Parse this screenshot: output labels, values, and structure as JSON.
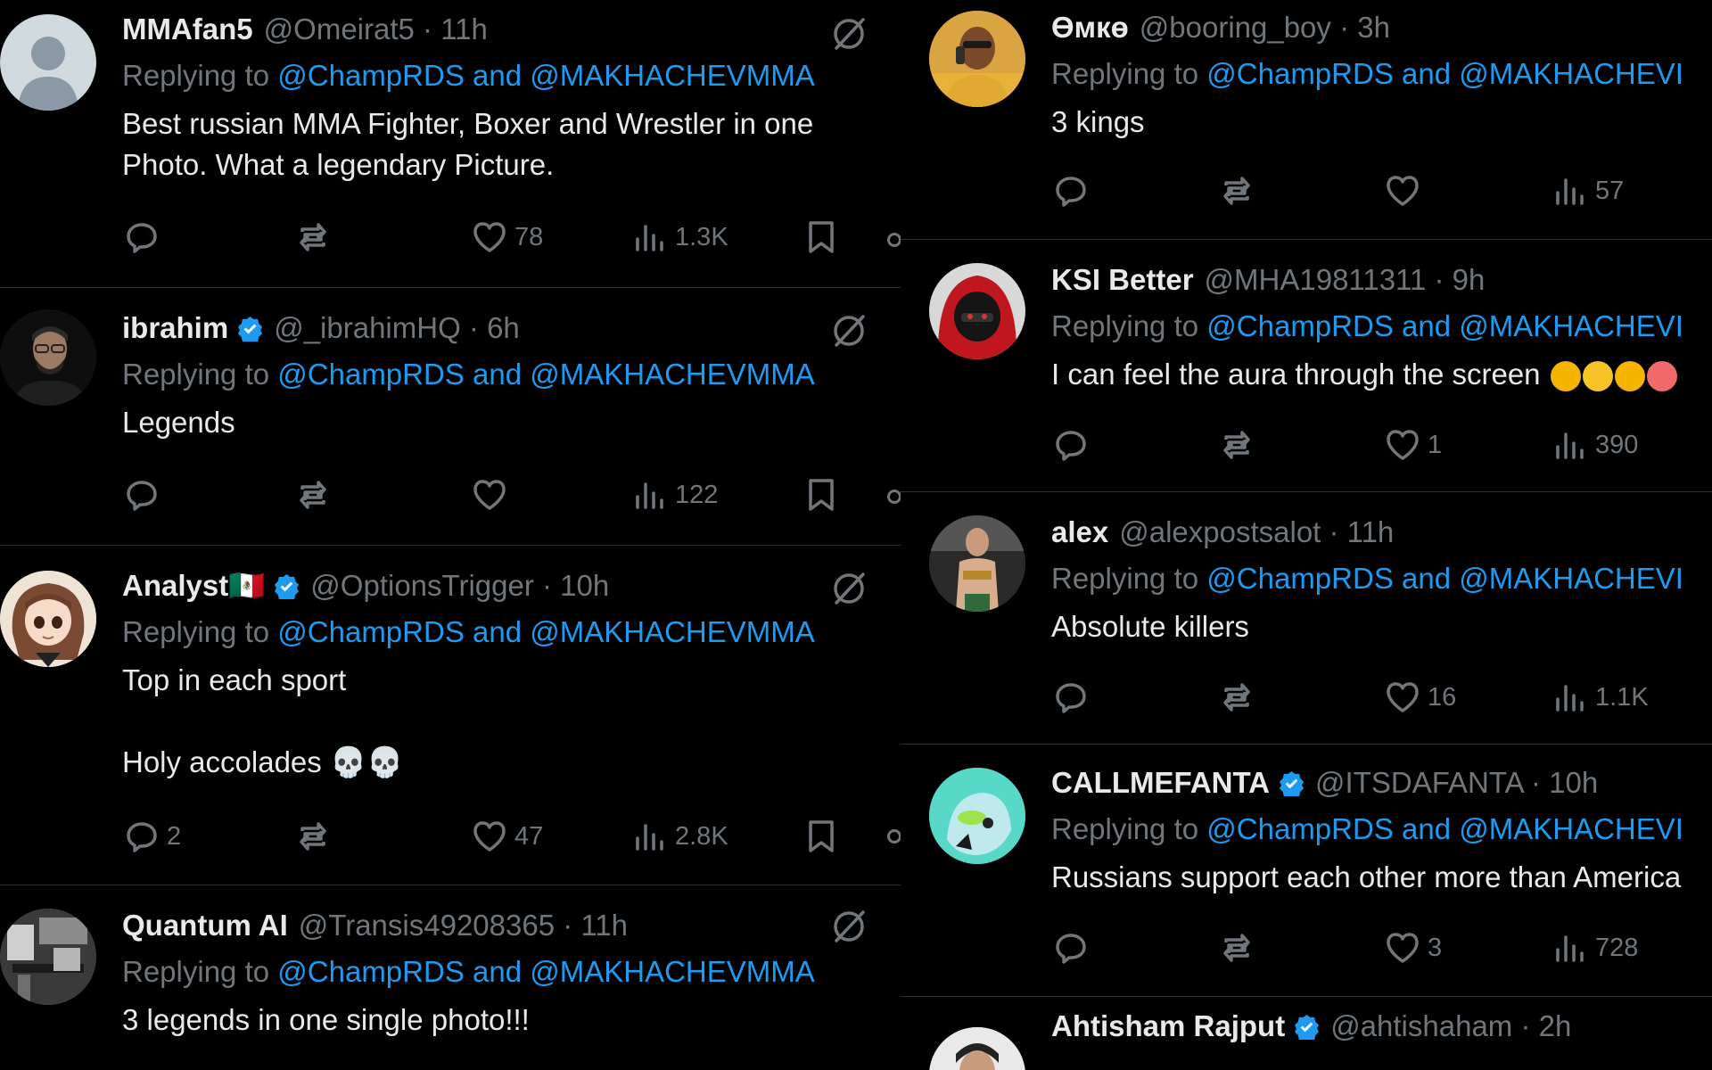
{
  "replying_prefix": "Replying to",
  "left_tweets": [
    {
      "name": "MMAfan5",
      "verified": false,
      "handle": "@Omeirat5 · 11h",
      "reply_to": "@ChampRDS and @MAKHACHEVMMA",
      "text": "Best russian MMA Fighter, Boxer and Wrestler in one Photo. What a legendary Picture.",
      "avatar": "default-avatar",
      "replies": "",
      "reposts": "",
      "likes": "78",
      "views": "1.3K"
    },
    {
      "name": "ibrahim",
      "verified": true,
      "handle": "@_ibrahimHQ · 6h",
      "reply_to": "@ChampRDS and @MAKHACHEVMMA",
      "text": "Legends",
      "avatar": "man-glasses-avatar",
      "replies": "",
      "reposts": "",
      "likes": "",
      "views": "122"
    },
    {
      "name": "Analyst🇲🇽",
      "verified": true,
      "handle": "@OptionsTrigger · 10h",
      "reply_to": "@ChampRDS and @MAKHACHEVMMA",
      "text": "Top in each sport\n\nHoly accolades 💀💀",
      "avatar": "anime-girl-avatar",
      "replies": "2",
      "reposts": "",
      "likes": "47",
      "views": "2.8K"
    },
    {
      "name": "Quantum AI",
      "verified": false,
      "handle": "@Transis49208365 · 11h",
      "reply_to": "@ChampRDS and @MAKHACHEVMMA",
      "text": "3 legends in one single photo!!!",
      "avatar": "photo-avatar",
      "replies": "",
      "reposts": "",
      "likes": "",
      "views": ""
    }
  ],
  "right_tweets": [
    {
      "name": "Өмкө",
      "verified": false,
      "handle": "@booring_boy · 3h",
      "reply_to": "@ChampRDS and @MAKHACHEVI",
      "text": "3 kings",
      "avatar": "man-phone-avatar",
      "replies": "",
      "reposts": "",
      "likes": "",
      "views": "57"
    },
    {
      "name": "KSI Better",
      "verified": false,
      "handle": "@MHA19811311 · 9h",
      "reply_to": "@ChampRDS and @MAKHACHEVI",
      "text": "I can feel the aura through the screen",
      "avatar": "red-hood-avatar",
      "replies": "",
      "reposts": "",
      "likes": "1",
      "views": "390"
    },
    {
      "name": "alex",
      "verified": false,
      "handle": "@alexpostsalot · 11h",
      "reply_to": "@ChampRDS and @MAKHACHEVI",
      "text": "Absolute killers",
      "avatar": "fighter-avatar",
      "replies": "",
      "reposts": "",
      "likes": "16",
      "views": "1.1K"
    },
    {
      "name": "CALLMEFANTA",
      "verified": true,
      "handle": "@ITSDAFANTA · 10h",
      "reply_to": "@ChampRDS and @MAKHACHEVI",
      "text": "Russians support each other more than America",
      "avatar": "cartoon-avatar",
      "replies": "",
      "reposts": "",
      "likes": "3",
      "views": "728"
    },
    {
      "name": "Ahtisham Rajput",
      "verified": true,
      "handle": "@ahtishaham · 2h",
      "reply_to": "",
      "text": "",
      "avatar": "portrait-avatar",
      "replies": "",
      "reposts": "",
      "likes": "",
      "views": ""
    }
  ],
  "colors": {
    "background": "#000000",
    "text": "#e7e9ea",
    "muted": "#71767b",
    "link": "#1d9bf0",
    "border": "#2f3336"
  }
}
